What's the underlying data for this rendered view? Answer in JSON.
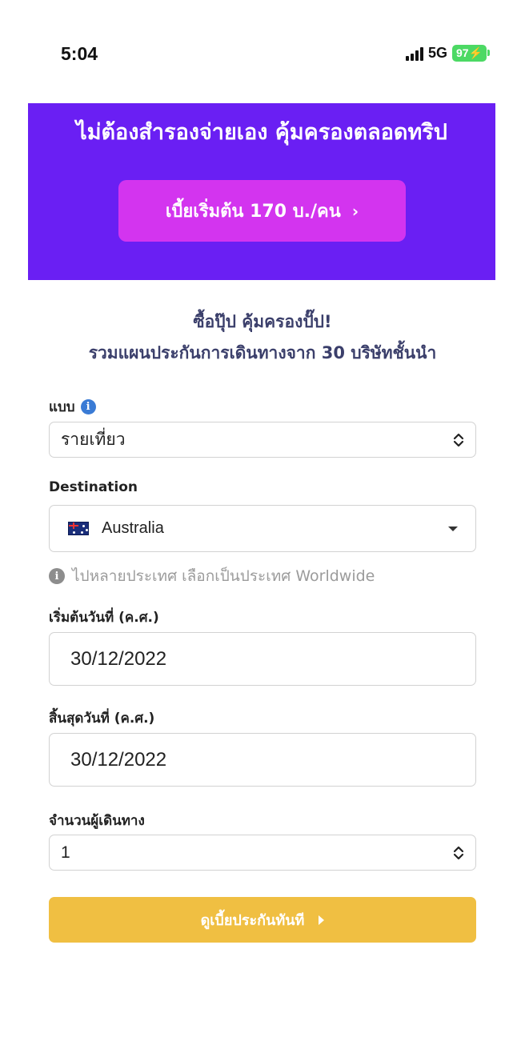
{
  "status_bar": {
    "time": "5:04",
    "network": "5G",
    "battery": "97"
  },
  "hero": {
    "title": "ไม่ต้องสำรองจ่ายเอง คุ้มครองตลอดทริป",
    "cta_label": "เบี้ยเริ่มต้น 170 บ./คน",
    "cta_chevron": "›",
    "background_color": "#6a1ff3",
    "button_color": "#d334ef"
  },
  "headline": {
    "line1": "ซื้อปุ๊ป คุ้มครองปั๊ป!",
    "line2": "รวมแผนประกันการเดินทางจาก 30 บริษัทชั้นนำ"
  },
  "form": {
    "plan_type": {
      "label": "แบบ",
      "info_icon": "i",
      "value": "รายเที่ยว"
    },
    "destination": {
      "label": "Destination",
      "flag_icon": "australia-flag-icon",
      "value": "Australia",
      "hint": "ไปหลายประเทศ เลือกเป็นประเทศ Worldwide",
      "hint_icon": "i"
    },
    "start_date": {
      "label": "เริ่มต้นวันที่ (ค.ศ.)",
      "value": "30/12/2022"
    },
    "end_date": {
      "label": "สิ้นสุดวันที่ (ค.ศ.)",
      "value": "30/12/2022"
    },
    "travelers": {
      "label": "จำนวนผู้เดินทาง",
      "value": "1"
    },
    "submit_label": "ดูเบี้ยประกันทันที",
    "submit_color": "#f0bf42"
  }
}
